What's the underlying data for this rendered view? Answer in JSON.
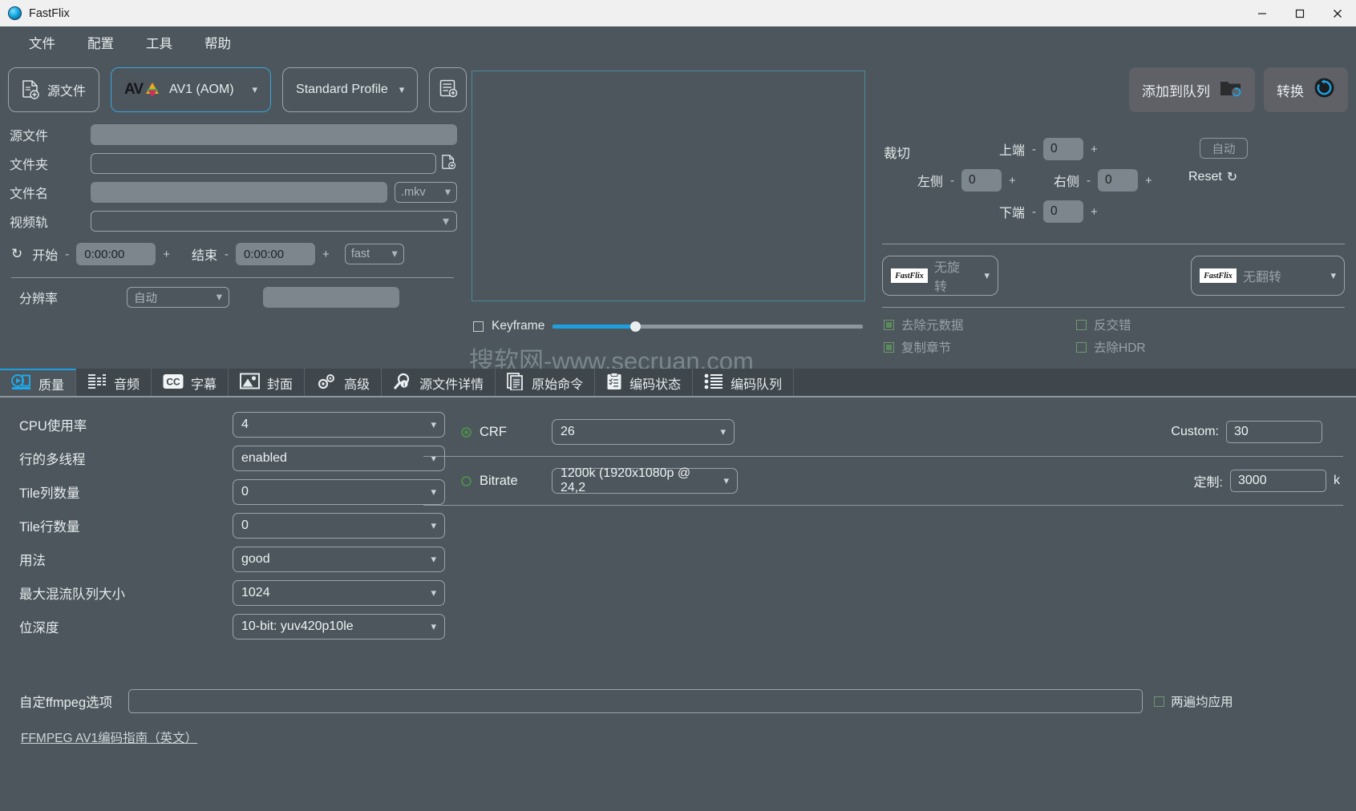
{
  "window": {
    "title": "FastFlix",
    "app_icon": "fastflix-globe-icon",
    "minimize": "–",
    "maximize": "□",
    "close": "✕"
  },
  "menubar": [
    {
      "label": "文件"
    },
    {
      "label": "配置"
    },
    {
      "label": "工具"
    },
    {
      "label": "帮助"
    }
  ],
  "toolbar": {
    "source_button": "源文件",
    "encoder": "AV1 (AOM)",
    "encoder_badge": "AV",
    "profile": "Standard Profile",
    "profile_icon": "profile-list-icon",
    "add_profile_icon": "add-profile-icon"
  },
  "left_form": {
    "rows": [
      {
        "label": "源文件",
        "value": ""
      },
      {
        "label": "文件夹",
        "value": ""
      },
      {
        "label": "文件名",
        "value": ""
      },
      {
        "label": "视频轨",
        "value": ""
      }
    ],
    "extension": ".mkv",
    "folder_browse_icon": "folder-browse-icon",
    "time": {
      "reset_icon": "reset-icon",
      "start_label": "开始",
      "start_value": "0:00:00",
      "end_label": "结束",
      "end_value": "0:00:00",
      "minus": "-",
      "plus": "+",
      "seek_mode": "fast"
    },
    "resolution": {
      "label": "分辨率",
      "value": "自动",
      "custom": ""
    }
  },
  "preview": {
    "keyframe_label": "Keyframe",
    "keyframe_checked": false,
    "slider_percent": 26
  },
  "right_panel": {
    "add_to_queue": "添加到队列",
    "add_to_queue_icon": "folder-queue-icon",
    "convert": "转换",
    "convert_icon": "convert-refresh-icon",
    "crop": {
      "title": "裁切",
      "top_label": "上端",
      "top_value": "0",
      "left_label": "左侧",
      "left_value": "0",
      "right_label": "右侧",
      "right_value": "0",
      "bottom_label": "下端",
      "bottom_value": "0",
      "minus": "-",
      "plus": "+",
      "auto": "自动",
      "reset": "Reset",
      "reset_icon": "reset-icon"
    },
    "rotate": {
      "value": "无旋转",
      "badge": "FastFlix"
    },
    "flip": {
      "value": "无翻转",
      "badge": "FastFlix"
    },
    "checkboxes": [
      {
        "label": "去除元数据",
        "checked": true
      },
      {
        "label": "反交错",
        "checked": false
      },
      {
        "label": "复制章节",
        "checked": true
      },
      {
        "label": "去除HDR",
        "checked": false
      }
    ]
  },
  "watermark": "搜软网-www.secruan.com",
  "tabs": [
    {
      "label": "质量",
      "icon": "quality-film-icon",
      "active": true
    },
    {
      "label": "音频",
      "icon": "audio-levels-icon",
      "active": false
    },
    {
      "label": "字幕",
      "icon": "cc-subtitle-icon",
      "active": false
    },
    {
      "label": "封面",
      "icon": "image-cover-icon",
      "active": false
    },
    {
      "label": "高级",
      "icon": "gears-advanced-icon",
      "active": false
    },
    {
      "label": "源文件详情",
      "icon": "magnifier-info-icon",
      "active": false
    },
    {
      "label": "原始命令",
      "icon": "document-command-icon",
      "active": false
    },
    {
      "label": "编码状态",
      "icon": "clipboard-status-icon",
      "active": false
    },
    {
      "label": "编码队列",
      "icon": "list-queue-icon",
      "active": false
    }
  ],
  "settings": {
    "rows": [
      {
        "label": "CPU使用率",
        "value": "4"
      },
      {
        "label": "行的多线程",
        "value": "enabled"
      },
      {
        "label": "Tile列数量",
        "value": "0"
      },
      {
        "label": "Tile行数量",
        "value": "0"
      },
      {
        "label": "用法",
        "value": "good"
      },
      {
        "label": "最大混流队列大小",
        "value": "1024"
      },
      {
        "label": "位深度",
        "value": "10-bit: yuv420p10le"
      }
    ]
  },
  "quality": {
    "crf": {
      "name": "CRF",
      "selected": true,
      "value": "26",
      "custom_label": "Custom:",
      "custom_value": "30"
    },
    "bitrate": {
      "name": "Bitrate",
      "selected": false,
      "value": "1200k (1920x1080p @ 24,2",
      "custom_label": "定制:",
      "custom_value": "3000",
      "unit": "k"
    }
  },
  "bottom": {
    "ffmpeg_label": "自定ffmpeg选项",
    "ffmpeg_value": "",
    "two_pass_label": "两遍均应用",
    "two_pass_checked": false,
    "guide_link": "FFMPEG AV1编码指南（英文）"
  },
  "colors": {
    "accent": "#1e9fe0",
    "background": "#4c565c",
    "panel": "#3f474d",
    "field": "#7d868c",
    "green": "#4d8a4d"
  }
}
